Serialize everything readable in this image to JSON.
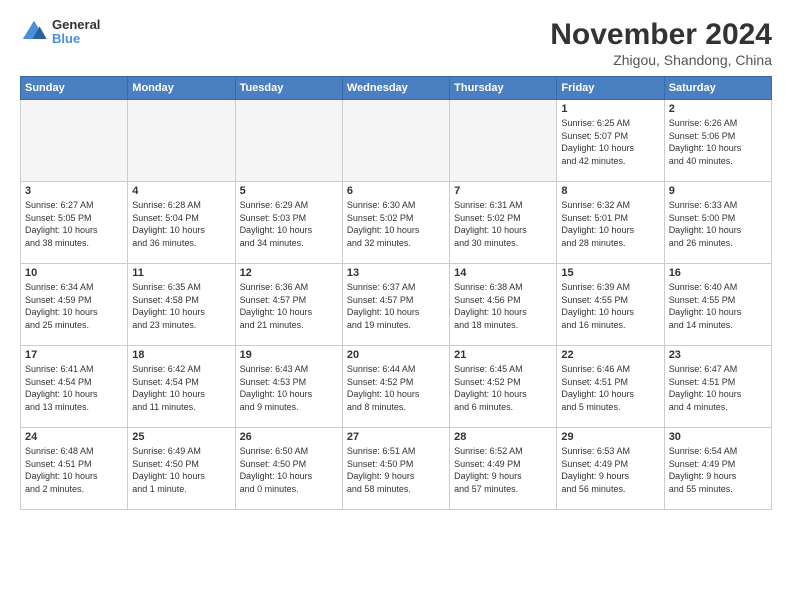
{
  "logo": {
    "general": "General",
    "blue": "Blue"
  },
  "title": "November 2024",
  "location": "Zhigou, Shandong, China",
  "days_of_week": [
    "Sunday",
    "Monday",
    "Tuesday",
    "Wednesday",
    "Thursday",
    "Friday",
    "Saturday"
  ],
  "weeks": [
    [
      {
        "day": "",
        "info": "",
        "empty": true
      },
      {
        "day": "",
        "info": "",
        "empty": true
      },
      {
        "day": "",
        "info": "",
        "empty": true
      },
      {
        "day": "",
        "info": "",
        "empty": true
      },
      {
        "day": "",
        "info": "",
        "empty": true
      },
      {
        "day": "1",
        "info": "Sunrise: 6:25 AM\nSunset: 5:07 PM\nDaylight: 10 hours\nand 42 minutes.",
        "empty": false
      },
      {
        "day": "2",
        "info": "Sunrise: 6:26 AM\nSunset: 5:06 PM\nDaylight: 10 hours\nand 40 minutes.",
        "empty": false
      }
    ],
    [
      {
        "day": "3",
        "info": "Sunrise: 6:27 AM\nSunset: 5:05 PM\nDaylight: 10 hours\nand 38 minutes.",
        "empty": false
      },
      {
        "day": "4",
        "info": "Sunrise: 6:28 AM\nSunset: 5:04 PM\nDaylight: 10 hours\nand 36 minutes.",
        "empty": false
      },
      {
        "day": "5",
        "info": "Sunrise: 6:29 AM\nSunset: 5:03 PM\nDaylight: 10 hours\nand 34 minutes.",
        "empty": false
      },
      {
        "day": "6",
        "info": "Sunrise: 6:30 AM\nSunset: 5:02 PM\nDaylight: 10 hours\nand 32 minutes.",
        "empty": false
      },
      {
        "day": "7",
        "info": "Sunrise: 6:31 AM\nSunset: 5:02 PM\nDaylight: 10 hours\nand 30 minutes.",
        "empty": false
      },
      {
        "day": "8",
        "info": "Sunrise: 6:32 AM\nSunset: 5:01 PM\nDaylight: 10 hours\nand 28 minutes.",
        "empty": false
      },
      {
        "day": "9",
        "info": "Sunrise: 6:33 AM\nSunset: 5:00 PM\nDaylight: 10 hours\nand 26 minutes.",
        "empty": false
      }
    ],
    [
      {
        "day": "10",
        "info": "Sunrise: 6:34 AM\nSunset: 4:59 PM\nDaylight: 10 hours\nand 25 minutes.",
        "empty": false
      },
      {
        "day": "11",
        "info": "Sunrise: 6:35 AM\nSunset: 4:58 PM\nDaylight: 10 hours\nand 23 minutes.",
        "empty": false
      },
      {
        "day": "12",
        "info": "Sunrise: 6:36 AM\nSunset: 4:57 PM\nDaylight: 10 hours\nand 21 minutes.",
        "empty": false
      },
      {
        "day": "13",
        "info": "Sunrise: 6:37 AM\nSunset: 4:57 PM\nDaylight: 10 hours\nand 19 minutes.",
        "empty": false
      },
      {
        "day": "14",
        "info": "Sunrise: 6:38 AM\nSunset: 4:56 PM\nDaylight: 10 hours\nand 18 minutes.",
        "empty": false
      },
      {
        "day": "15",
        "info": "Sunrise: 6:39 AM\nSunset: 4:55 PM\nDaylight: 10 hours\nand 16 minutes.",
        "empty": false
      },
      {
        "day": "16",
        "info": "Sunrise: 6:40 AM\nSunset: 4:55 PM\nDaylight: 10 hours\nand 14 minutes.",
        "empty": false
      }
    ],
    [
      {
        "day": "17",
        "info": "Sunrise: 6:41 AM\nSunset: 4:54 PM\nDaylight: 10 hours\nand 13 minutes.",
        "empty": false
      },
      {
        "day": "18",
        "info": "Sunrise: 6:42 AM\nSunset: 4:54 PM\nDaylight: 10 hours\nand 11 minutes.",
        "empty": false
      },
      {
        "day": "19",
        "info": "Sunrise: 6:43 AM\nSunset: 4:53 PM\nDaylight: 10 hours\nand 9 minutes.",
        "empty": false
      },
      {
        "day": "20",
        "info": "Sunrise: 6:44 AM\nSunset: 4:52 PM\nDaylight: 10 hours\nand 8 minutes.",
        "empty": false
      },
      {
        "day": "21",
        "info": "Sunrise: 6:45 AM\nSunset: 4:52 PM\nDaylight: 10 hours\nand 6 minutes.",
        "empty": false
      },
      {
        "day": "22",
        "info": "Sunrise: 6:46 AM\nSunset: 4:51 PM\nDaylight: 10 hours\nand 5 minutes.",
        "empty": false
      },
      {
        "day": "23",
        "info": "Sunrise: 6:47 AM\nSunset: 4:51 PM\nDaylight: 10 hours\nand 4 minutes.",
        "empty": false
      }
    ],
    [
      {
        "day": "24",
        "info": "Sunrise: 6:48 AM\nSunset: 4:51 PM\nDaylight: 10 hours\nand 2 minutes.",
        "empty": false
      },
      {
        "day": "25",
        "info": "Sunrise: 6:49 AM\nSunset: 4:50 PM\nDaylight: 10 hours\nand 1 minute.",
        "empty": false
      },
      {
        "day": "26",
        "info": "Sunrise: 6:50 AM\nSunset: 4:50 PM\nDaylight: 10 hours\nand 0 minutes.",
        "empty": false
      },
      {
        "day": "27",
        "info": "Sunrise: 6:51 AM\nSunset: 4:50 PM\nDaylight: 9 hours\nand 58 minutes.",
        "empty": false
      },
      {
        "day": "28",
        "info": "Sunrise: 6:52 AM\nSunset: 4:49 PM\nDaylight: 9 hours\nand 57 minutes.",
        "empty": false
      },
      {
        "day": "29",
        "info": "Sunrise: 6:53 AM\nSunset: 4:49 PM\nDaylight: 9 hours\nand 56 minutes.",
        "empty": false
      },
      {
        "day": "30",
        "info": "Sunrise: 6:54 AM\nSunset: 4:49 PM\nDaylight: 9 hours\nand 55 minutes.",
        "empty": false
      }
    ]
  ]
}
